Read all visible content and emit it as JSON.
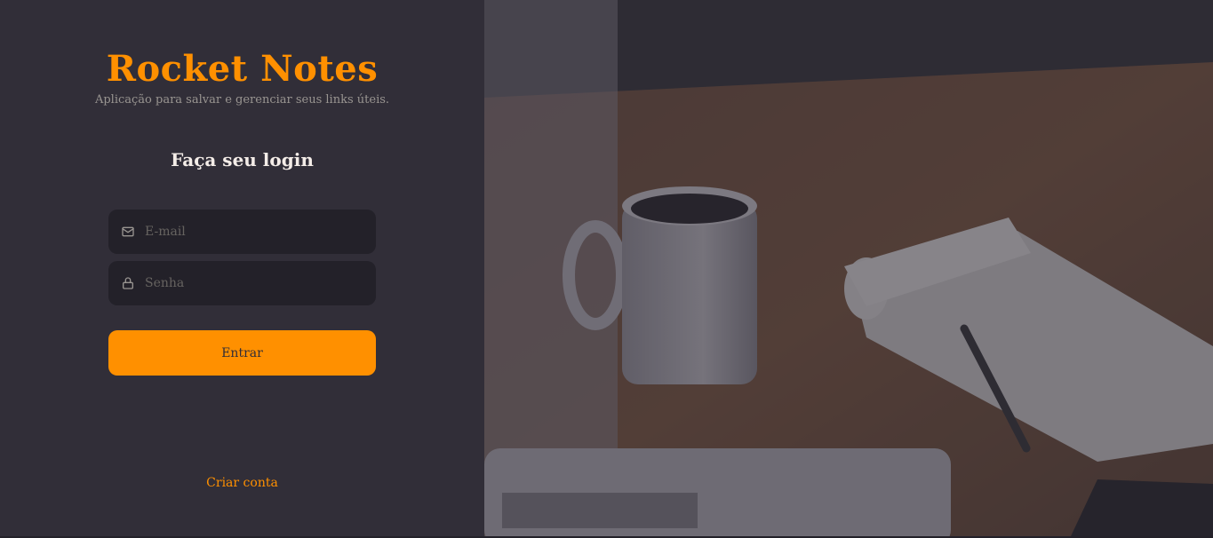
{
  "brand": {
    "title": "Rocket Notes",
    "subtitle": "Aplicação para salvar e gerenciar seus links úteis."
  },
  "login": {
    "heading": "Faça seu login",
    "email": {
      "placeholder": "E-mail",
      "value": "",
      "icon": "mail-icon"
    },
    "password": {
      "placeholder": "Senha",
      "value": "",
      "icon": "lock-icon"
    },
    "submit_label": "Entrar",
    "create_account_label": "Criar conta"
  },
  "colors": {
    "accent": "#ff9000",
    "background": "#312e38",
    "input_background": "#232129",
    "text": "#f4ede8",
    "muted_text": "#999591",
    "placeholder": "#666360"
  }
}
